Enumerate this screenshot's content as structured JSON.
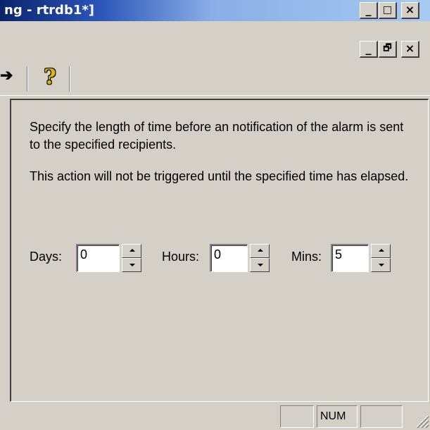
{
  "window": {
    "title": "ng - rtrdb1*]",
    "minimize_label": "_",
    "maximize_label": "□",
    "close_label": "×",
    "child_restore_label": "🗗"
  },
  "toolbar": {
    "arrow_glyph": "➔",
    "help_glyph": "?"
  },
  "panel": {
    "description": "Specify the length of time before an notification of the alarm is sent to the specified recipients.",
    "note": "This action will not be triggered until the specified time has elapsed.",
    "fields": {
      "days": {
        "label": "Days:",
        "value": "0"
      },
      "hours": {
        "label": "Hours:",
        "value": "0"
      },
      "mins": {
        "label": "Mins:",
        "value": "5"
      }
    }
  },
  "statusbar": {
    "num": "NUM"
  }
}
